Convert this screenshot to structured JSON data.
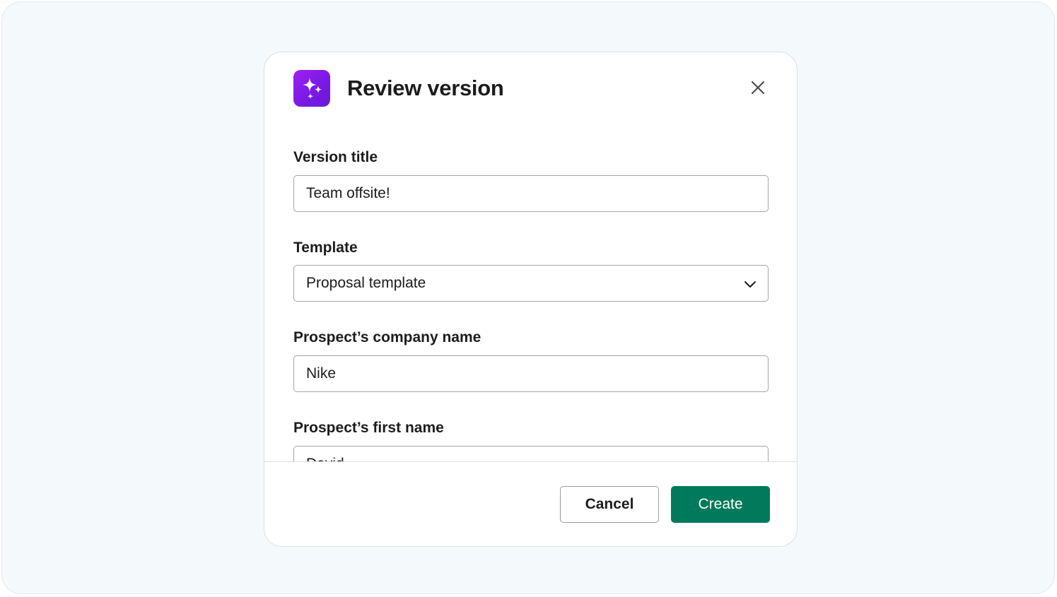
{
  "modal": {
    "title": "Review version",
    "icon": "sparkles-icon",
    "icon_gradient": [
      "#a020f0",
      "#6a16d8"
    ],
    "close_icon": "close-icon"
  },
  "fields": {
    "version_title": {
      "label": "Version title",
      "value": "Team offsite!"
    },
    "template": {
      "label": "Template",
      "value": "Proposal template",
      "icon": "chevron-down-icon"
    },
    "company_name": {
      "label": "Prospect’s company name",
      "value": "Nike"
    },
    "first_name": {
      "label": "Prospect’s first name",
      "value": "David"
    }
  },
  "footer": {
    "cancel_label": "Cancel",
    "create_label": "Create",
    "primary_color": "#007a5a"
  }
}
